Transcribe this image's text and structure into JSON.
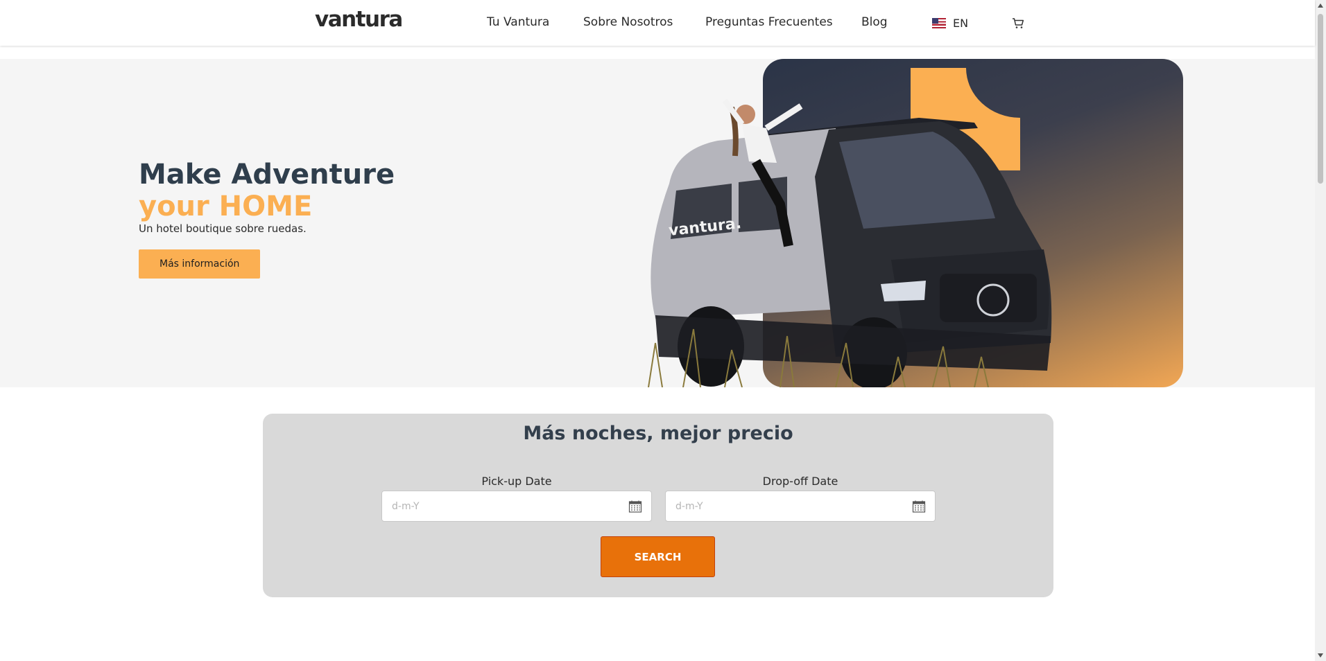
{
  "header": {
    "logo": "vantura",
    "nav": [
      "Tu Vantura",
      "Sobre Nosotros",
      "Preguntas Frecuentes",
      "Blog"
    ],
    "language": "EN",
    "flag_icon": "us-flag-icon",
    "cart_icon": "cart-icon"
  },
  "hero": {
    "title_line1": "Make Adventure",
    "title_line2": "your HOME",
    "subtitle": "Un hotel boutique sobre ruedas.",
    "button": "Más información",
    "image_alt_icon": "van-photo",
    "van_brand_text": "vantura."
  },
  "search": {
    "title": "Más noches, mejor precio",
    "pickup_label": "Pick-up Date",
    "pickup_placeholder": "d-m-Y",
    "dropoff_label": "Drop-off Date",
    "dropoff_placeholder": "d-m-Y",
    "button": "SEARCH"
  },
  "colors": {
    "accent": "#fbaf52",
    "dark": "#2f3e4c",
    "search_button": "#e8710a",
    "search_panel": "#d9d9d9"
  }
}
